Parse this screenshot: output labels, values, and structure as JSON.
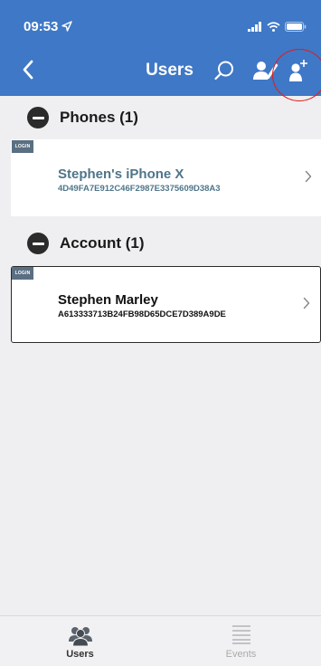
{
  "status_bar": {
    "time": "09:53",
    "icons": [
      "location-arrow-icon",
      "signal-icon",
      "wifi-icon",
      "battery-icon"
    ]
  },
  "nav": {
    "title": "Users",
    "icons": [
      "back-chevron-icon",
      "search-icon",
      "edit-user-icon",
      "add-user-icon"
    ],
    "highlight_color": "#e21b1b"
  },
  "sections": [
    {
      "title": "Phones (1)",
      "items": [
        {
          "badge": "LOGIN",
          "name": "Stephen's iPhone X",
          "id": "4D49FA7E912C46F2987E3375609D38A3"
        }
      ]
    },
    {
      "title": "Account (1)",
      "items": [
        {
          "badge": "LOGIN",
          "name": "Stephen Marley",
          "id": "A613333713B24FB98D65DCE7D389A9DE"
        }
      ]
    }
  ],
  "tabs": [
    {
      "label": "Users",
      "icon": "users-icon",
      "active": true
    },
    {
      "label": "Events",
      "icon": "list-icon",
      "active": false
    }
  ],
  "colors": {
    "header": "#3f78c6",
    "background": "#efeff1",
    "phone_text": "#4e7589",
    "badge": "#5a6f82"
  }
}
